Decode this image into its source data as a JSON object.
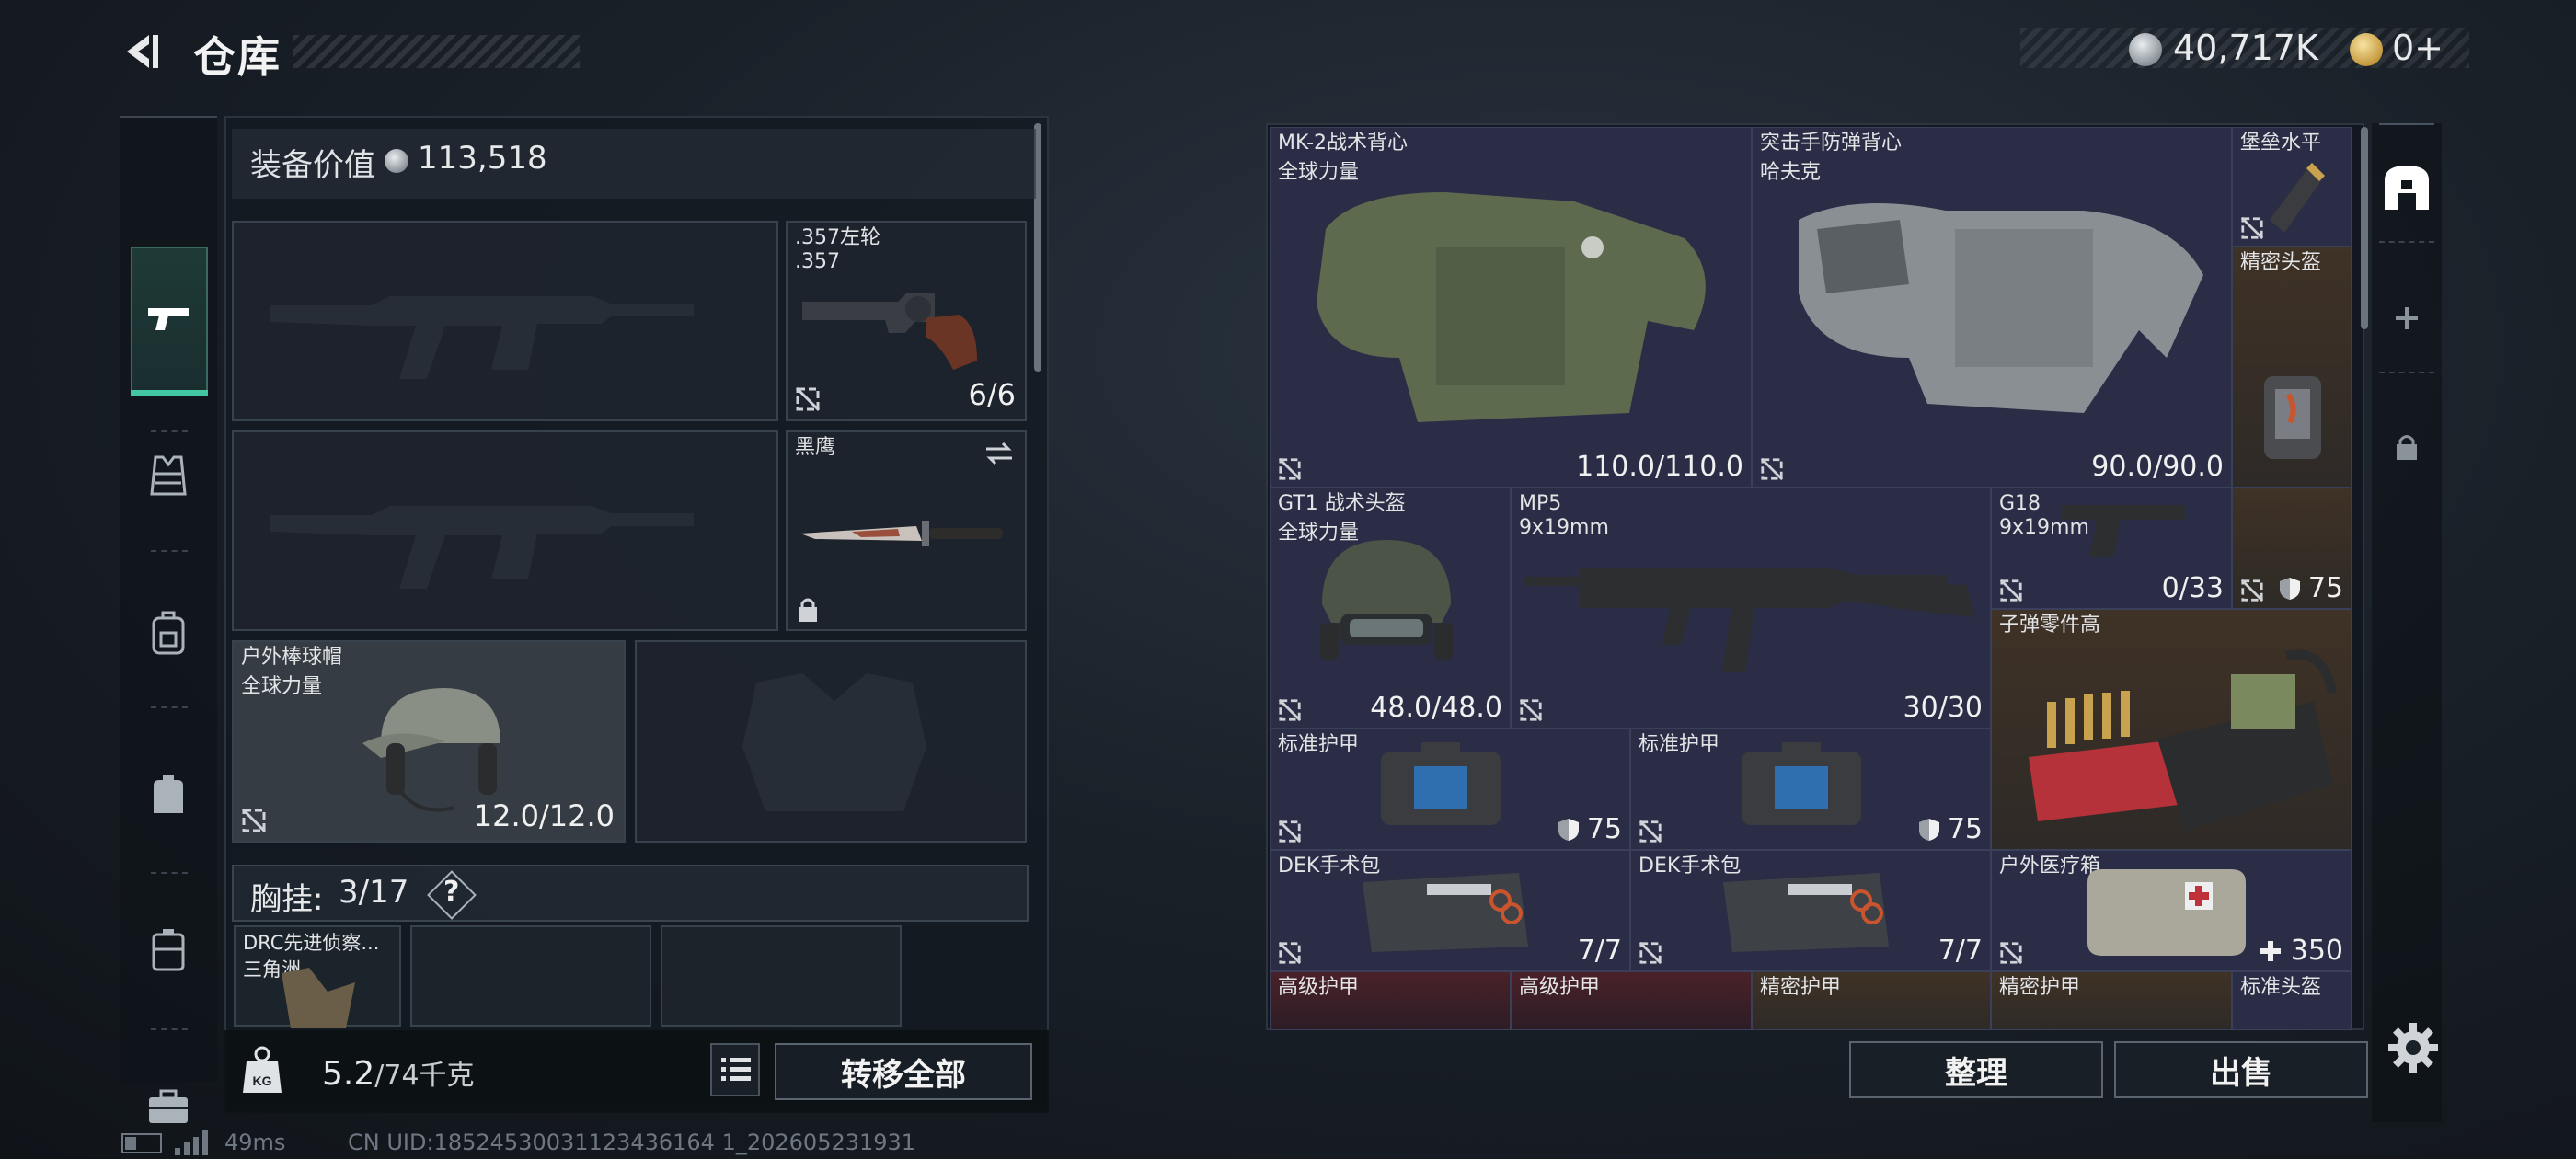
{
  "header": {
    "title": "仓库"
  },
  "currency": {
    "silver": "40,717K",
    "gold": "0+"
  },
  "left_nav": {
    "items": [
      {
        "icon": "pistol-icon",
        "active": true
      },
      {
        "icon": "vest-icon"
      },
      {
        "icon": "backpack-icon"
      },
      {
        "icon": "pack-icon"
      },
      {
        "icon": "case-icon"
      },
      {
        "icon": "briefcase-icon"
      }
    ]
  },
  "equipment": {
    "value_label": "装备价值",
    "value": "113,518",
    "slots": {
      "pistol": {
        "name": ".357左轮",
        "sub": ".357",
        "value": "6/6"
      },
      "melee": {
        "name": "黑鹰"
      },
      "helmet": {
        "name": "户外棒球帽",
        "sub": "全球力量",
        "value": "12.0/12.0"
      }
    },
    "chest_rig": {
      "label": "胸挂:",
      "count": "3/17",
      "help": "?"
    },
    "rig_items": [
      {
        "name": "DRC先进侦察...",
        "sub": "三角洲"
      }
    ]
  },
  "footer_left": {
    "weight_current": "5.2",
    "weight_max": "/74千克",
    "transfer_all": "转移全部"
  },
  "stash": {
    "items": [
      {
        "id": "mk2",
        "name": "MK-2战术背心",
        "sub": "全球力量",
        "value": "110.0/110.0"
      },
      {
        "id": "assault",
        "name": "突击手防弹背心",
        "sub": "哈夫克",
        "value": "90.0/90.0"
      },
      {
        "id": "fortress",
        "name": "堡垒水平"
      },
      {
        "id": "precision-helmet",
        "name": "精密头盔"
      },
      {
        "id": "gt1",
        "name": "GT1 战术头盔",
        "sub": "全球力量",
        "value": "48.0/48.0"
      },
      {
        "id": "mp5",
        "name": "MP5",
        "sub": "9x19mm",
        "value": "30/30"
      },
      {
        "id": "g18",
        "name": "G18",
        "sub": "9x19mm",
        "value": "0/33"
      },
      {
        "id": "precision-helmet-val",
        "value": "75"
      },
      {
        "id": "ammo-parts",
        "name": "子弹零件高"
      },
      {
        "id": "std-armor-1",
        "name": "标准护甲",
        "value": "75"
      },
      {
        "id": "std-armor-2",
        "name": "标准护甲",
        "value": "75"
      },
      {
        "id": "dek-1",
        "name": "DEK手术包",
        "value": "7/7"
      },
      {
        "id": "dek-2",
        "name": "DEK手术包",
        "value": "7/7"
      },
      {
        "id": "outdoor-med",
        "name": "户外医疗箱",
        "value": "350"
      },
      {
        "id": "adv-armor",
        "name": "高级护甲"
      },
      {
        "id": "adv-armor-2",
        "name": "高级护甲"
      },
      {
        "id": "prec-armor-1",
        "name": "精密护甲"
      },
      {
        "id": "prec-armor-2",
        "name": "精密护甲"
      },
      {
        "id": "std-helmet",
        "name": "标准头盔"
      }
    ]
  },
  "footer_right": {
    "sort": "整理",
    "sell": "出售"
  },
  "status": {
    "ping": "49ms",
    "uid": "CN UID:18524530031123436164 1_202605231931"
  },
  "colors": {
    "accent": "#43c7a2",
    "cell_bg": "#2a2d45",
    "warm_cell": "#3f3226",
    "red_cell": "#4a2128"
  }
}
